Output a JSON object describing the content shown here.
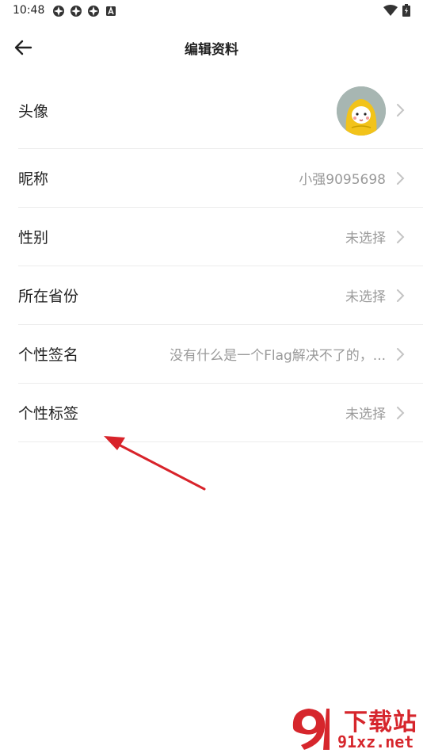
{
  "status_bar": {
    "time": "10:48",
    "left_icons": [
      "app-notification-icon",
      "app-notification-icon",
      "app-notification-icon",
      "text-a-icon"
    ],
    "right_icons": [
      "wifi-icon",
      "battery-charging-icon"
    ]
  },
  "header": {
    "title": "编辑资料",
    "back_icon": "back-arrow-icon"
  },
  "rows": {
    "avatar": {
      "label": "头像"
    },
    "nickname": {
      "label": "昵称",
      "value": "小强9095698"
    },
    "gender": {
      "label": "性别",
      "value": "未选择"
    },
    "province": {
      "label": "所在省份",
      "value": "未选择"
    },
    "signature": {
      "label": "个性签名",
      "value": "没有什么是一个Flag解决不了的，..."
    },
    "tags": {
      "label": "个性标签",
      "value": "未选择"
    }
  },
  "annotation": {
    "color": "#d8232a"
  },
  "watermark": {
    "logo_text": "9",
    "title": "下载站",
    "url": "91xz.net",
    "color": "#d6262c"
  },
  "colors": {
    "text_primary": "#222222",
    "text_secondary": "#9a9a9a",
    "divider": "#ececec"
  }
}
